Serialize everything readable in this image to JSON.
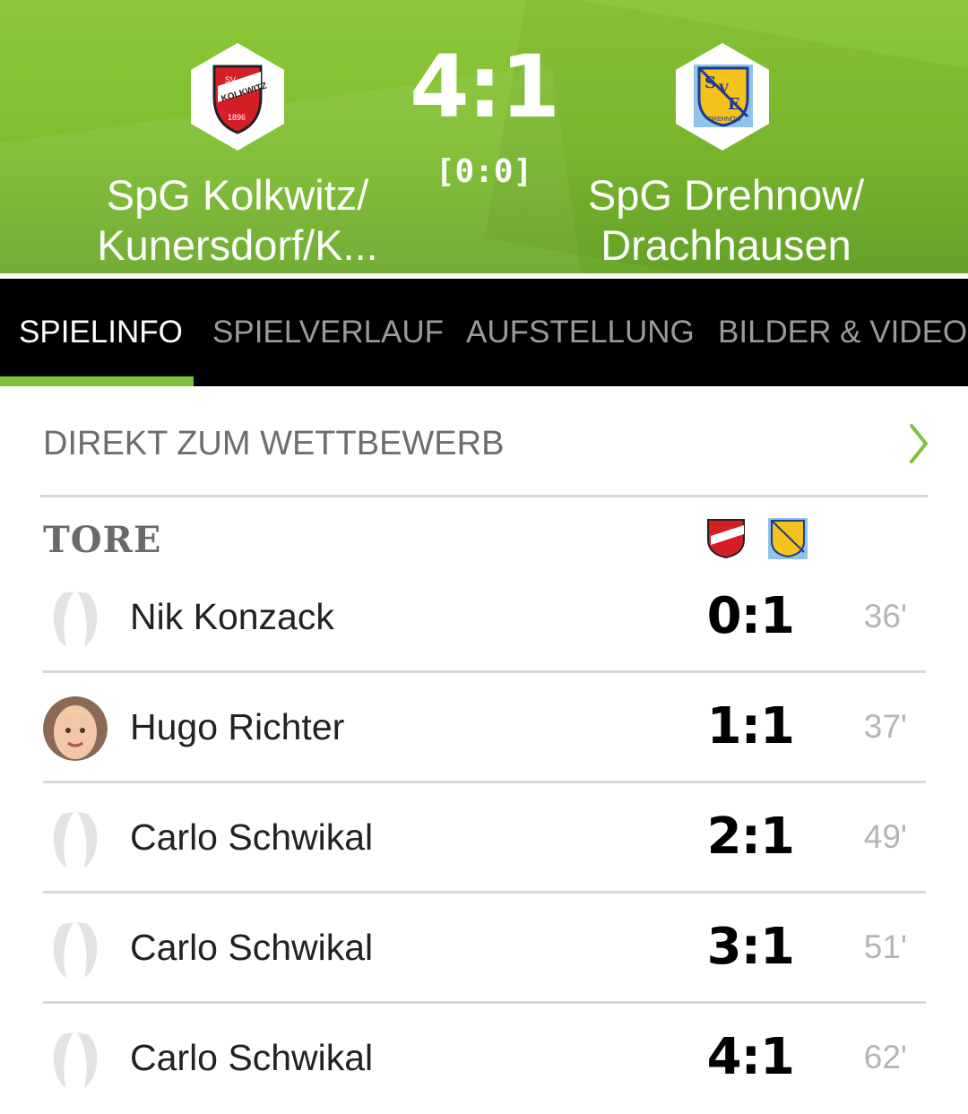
{
  "match": {
    "score": "4:1",
    "halftime": "[0:0]",
    "home": {
      "name_line1": "SpG Kolkwitz/",
      "name_line2": "Kunersdorf/K...",
      "crest": "sv-kolkwitz-1896-crest",
      "crest_text_top": "SV",
      "crest_text_main": "KOLKWITZ",
      "crest_year": "1896",
      "color": "#d41f26"
    },
    "away": {
      "name_line1": "SpG Drehnow/",
      "name_line2": "Drachhausen",
      "crest": "sve-drehnow-crest",
      "crest_text_s": "S",
      "crest_text_v": "V",
      "crest_text_e": "E",
      "crest_text_bottom": "DREHNOW",
      "color": "#f3c21b",
      "color_secondary": "#1f3a8f"
    }
  },
  "tabs": [
    {
      "label": "SPIELINFO",
      "active": true
    },
    {
      "label": "SPIELVERLAUF",
      "active": false
    },
    {
      "label": "AUFSTELLUNG",
      "active": false
    },
    {
      "label": "BILDER & VIDEOS",
      "active": false
    }
  ],
  "competition_link": {
    "label": "DIREKT ZUM WETTBEWERB",
    "icon": "chevron-right-icon"
  },
  "goals": {
    "heading": "TORE",
    "rows": [
      {
        "player": "Nik Konzack",
        "score": "0:1",
        "minute": "36'",
        "avatar": "placeholder-avatar"
      },
      {
        "player": "Hugo Richter",
        "score": "1:1",
        "minute": "37'",
        "avatar": "player-photo"
      },
      {
        "player": "Carlo Schwikal",
        "score": "2:1",
        "minute": "49'",
        "avatar": "placeholder-avatar"
      },
      {
        "player": "Carlo Schwikal",
        "score": "3:1",
        "minute": "51'",
        "avatar": "placeholder-avatar"
      },
      {
        "player": "Carlo Schwikal",
        "score": "4:1",
        "minute": "62'",
        "avatar": "placeholder-avatar"
      }
    ]
  },
  "colors": {
    "header_green": "#7fbf2f",
    "accent_green": "#7cc13a",
    "tabbar": "#000000"
  }
}
